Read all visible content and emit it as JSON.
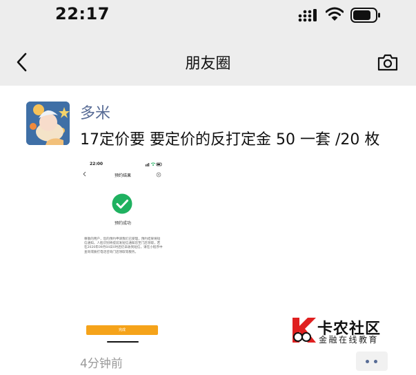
{
  "status_bar": {
    "time": "22:17"
  },
  "nav": {
    "title": "朋友圈",
    "back_icon": "chevron-left-icon",
    "camera_icon": "camera-icon"
  },
  "post": {
    "username": "多米",
    "text": "17定价要 要定价的反打定金 50 一套 /20 枚",
    "time_ago": "4分钟前",
    "username_color": "#576b95"
  },
  "attached_screenshot": {
    "time": "22:00",
    "title": "预约结果",
    "success_text": "预约成功",
    "description": "尊敬的用户，您的预约申请我们已受理，预约结果将短信通知，人脸识别将提前发短信通知您至门店领取，若在2020年09月04日0时后仍未收到短信，请在小程序中查询或拨打电话咨询门店领取等服务。",
    "button_label": "完成",
    "accent_color": "#f5a31a",
    "check_color": "#1fb160"
  },
  "watermark": {
    "title": "卡农社区",
    "subtitle": "金融在线教育",
    "brand_color": "#e02020"
  }
}
